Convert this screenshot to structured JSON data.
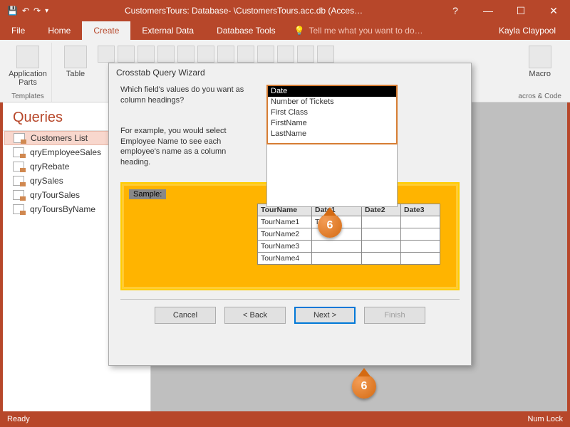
{
  "titlebar": {
    "title": "CustomersTours: Database- \\CustomersTours.acc.db (Acces…",
    "help": "?"
  },
  "ribbon": {
    "tabs": [
      "File",
      "Home",
      "Create",
      "External Data",
      "Database Tools"
    ],
    "active": "Create",
    "tellme": "Tell me what you want to do…",
    "user": "Kayla Claypool",
    "groups": {
      "templates": "Templates",
      "app_parts": "Application\nParts",
      "table": "Table",
      "tables": "",
      "macros": "acros & Code",
      "macro": "Macro"
    }
  },
  "navpane": {
    "header": "Queries",
    "items": [
      "Customers List",
      "qryEmployeeSales",
      "qryRebate",
      "qrySales",
      "qryTourSales",
      "qryToursByName"
    ]
  },
  "wizard": {
    "title": "Crosstab Query Wizard",
    "question": "Which field's values do you want as column headings?",
    "example": "For example, you would select Employee Name to see each employee's name as a column heading.",
    "fields": [
      "Date",
      "Number of Tickets",
      "First Class",
      "FirstName",
      "LastName"
    ],
    "selected_field": "Date",
    "sample": {
      "label": "Sample:",
      "headers": [
        "TourName",
        "Date1",
        "Date2",
        "Date3"
      ],
      "rows": [
        [
          "TourName1",
          "TOTAL",
          "",
          ""
        ],
        [
          "TourName2",
          "",
          "",
          ""
        ],
        [
          "TourName3",
          "",
          "",
          ""
        ],
        [
          "TourName4",
          "",
          "",
          ""
        ]
      ]
    },
    "buttons": {
      "cancel": "Cancel",
      "back": "< Back",
      "next": "Next >",
      "finish": "Finish"
    }
  },
  "callouts": {
    "n1": "6",
    "n2": "6"
  },
  "status": {
    "ready": "Ready",
    "numlock": "Num Lock"
  }
}
